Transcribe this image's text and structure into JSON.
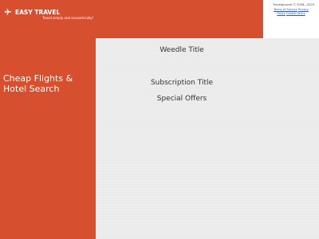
{
  "brand": {
    "name": "EASY TRAVEL",
    "tagline": "Travel simply and economically!"
  },
  "legal": {
    "copyright": "Travelguyonb © 2008—2020",
    "links": [
      "Terms of Service",
      "Privacy Policy",
      "Cookie Policy"
    ]
  },
  "sidebar": {
    "title": "Cheap Flights & Hotel Search"
  },
  "main": {
    "weedle_title": "Weedle Title",
    "subscription_title": "Subscription Title",
    "special_offers": "Special Offers"
  },
  "colors": {
    "brand": "#d6502f",
    "background": "#efefef",
    "link": "#2a56c6"
  },
  "icons": {
    "logo": "airplane-icon"
  }
}
